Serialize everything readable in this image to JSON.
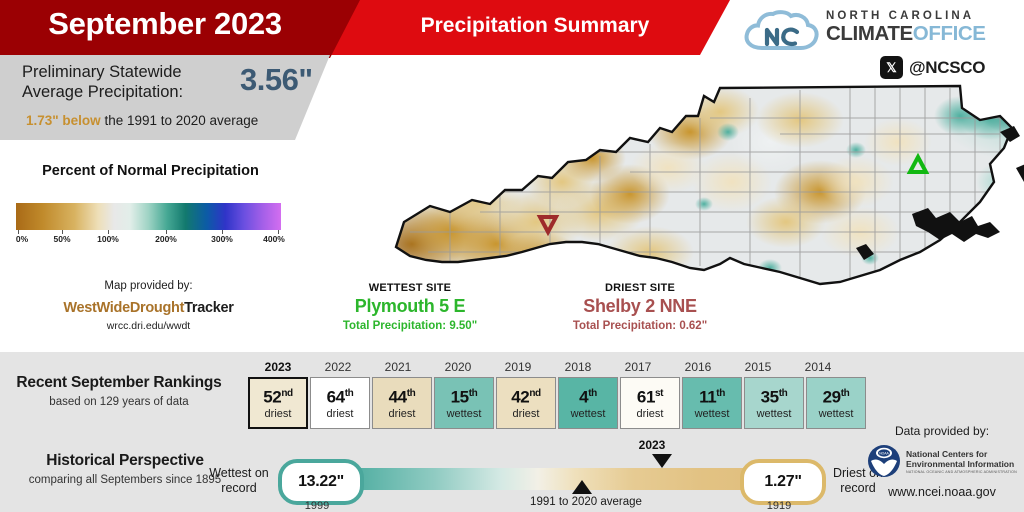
{
  "header": {
    "title": "September 2023",
    "subtitle": "Precipitation Summary",
    "logo": {
      "line1": "NORTH CAROLINA",
      "line2_dark": "CLIMATE",
      "line2_light": "OFFICE",
      "social_icon": "x-twitter-icon",
      "social_handle": "@NCSCO"
    }
  },
  "stat": {
    "label": "Preliminary Statewide Average Precipitation:",
    "value": "3.56\"",
    "departure_amount": "1.73\" below",
    "departure_rest": " the 1991 to 2020 average",
    "value_color": "#3c5a74",
    "departure_color": "#c79030"
  },
  "legend": {
    "title": "Percent of Normal Precipitation",
    "ticks": [
      "0%",
      "50%",
      "100%",
      "200%",
      "300%",
      "400%"
    ],
    "map_provided_by": "Map provided by:",
    "source_a": "WestWideDrought",
    "source_b": "Tracker",
    "source_url": "wrcc.dri.edu/wwdt"
  },
  "sites": {
    "wettest": {
      "heading": "WETTEST SITE",
      "name": "Plymouth 5 E",
      "total": "Total Precipitation: 9.50\"",
      "color": "#2cb62c",
      "marker": "up-triangle-marker"
    },
    "driest": {
      "heading": "DRIEST SITE",
      "name": "Shelby 2 NNE",
      "total": "Total Precipitation: 0.62\"",
      "color": "#a85050",
      "marker": "down-triangle-marker"
    }
  },
  "rankings": {
    "title": "Recent September Rankings",
    "subtitle": "based on 129 years of data",
    "years": [
      "2023",
      "2022",
      "2021",
      "2020",
      "2019",
      "2018",
      "2017",
      "2016",
      "2015",
      "2014"
    ],
    "items": [
      {
        "rank": "52",
        "suffix": "nd",
        "category": "driest",
        "bg": "#f0e8d2",
        "current": true
      },
      {
        "rank": "64",
        "suffix": "th",
        "category": "driest",
        "bg": "#ffffff",
        "current": false
      },
      {
        "rank": "44",
        "suffix": "th",
        "category": "driest",
        "bg": "#e9dcbc",
        "current": false
      },
      {
        "rank": "15",
        "suffix": "th",
        "category": "wettest",
        "bg": "#79c2b5",
        "current": false
      },
      {
        "rank": "42",
        "suffix": "nd",
        "category": "driest",
        "bg": "#ecdfc0",
        "current": false
      },
      {
        "rank": "4",
        "suffix": "th",
        "category": "wettest",
        "bg": "#58b5a5",
        "current": false
      },
      {
        "rank": "61",
        "suffix": "st",
        "category": "driest",
        "bg": "#fdfbf5",
        "current": false
      },
      {
        "rank": "11",
        "suffix": "th",
        "category": "wettest",
        "bg": "#67bcae",
        "current": false
      },
      {
        "rank": "35",
        "suffix": "th",
        "category": "wettest",
        "bg": "#a7d6cd",
        "current": false
      },
      {
        "rank": "29",
        "suffix": "th",
        "category": "wettest",
        "bg": "#9ad2c8",
        "current": false
      }
    ]
  },
  "historical": {
    "title": "Historical Perspective",
    "subtitle": "comparing all Septembers since 1895",
    "wettest_label": "Wettest on record",
    "wettest_value": "13.22\"",
    "wettest_year": "1999",
    "driest_label": "Driest on record",
    "driest_value": "1.27\"",
    "driest_year": "1919",
    "average_label": "1991 to 2020 average",
    "current_label": "2023"
  },
  "attribution": {
    "data_provided_by": "Data provided by:",
    "agency_line1": "National Centers for",
    "agency_line2": "Environmental Information",
    "agency_line3": "NATIONAL OCEANIC AND ATMOSPHERIC ADMINISTRATION",
    "url": "www.ncei.noaa.gov",
    "logo_icon": "noaa-seal-icon"
  }
}
